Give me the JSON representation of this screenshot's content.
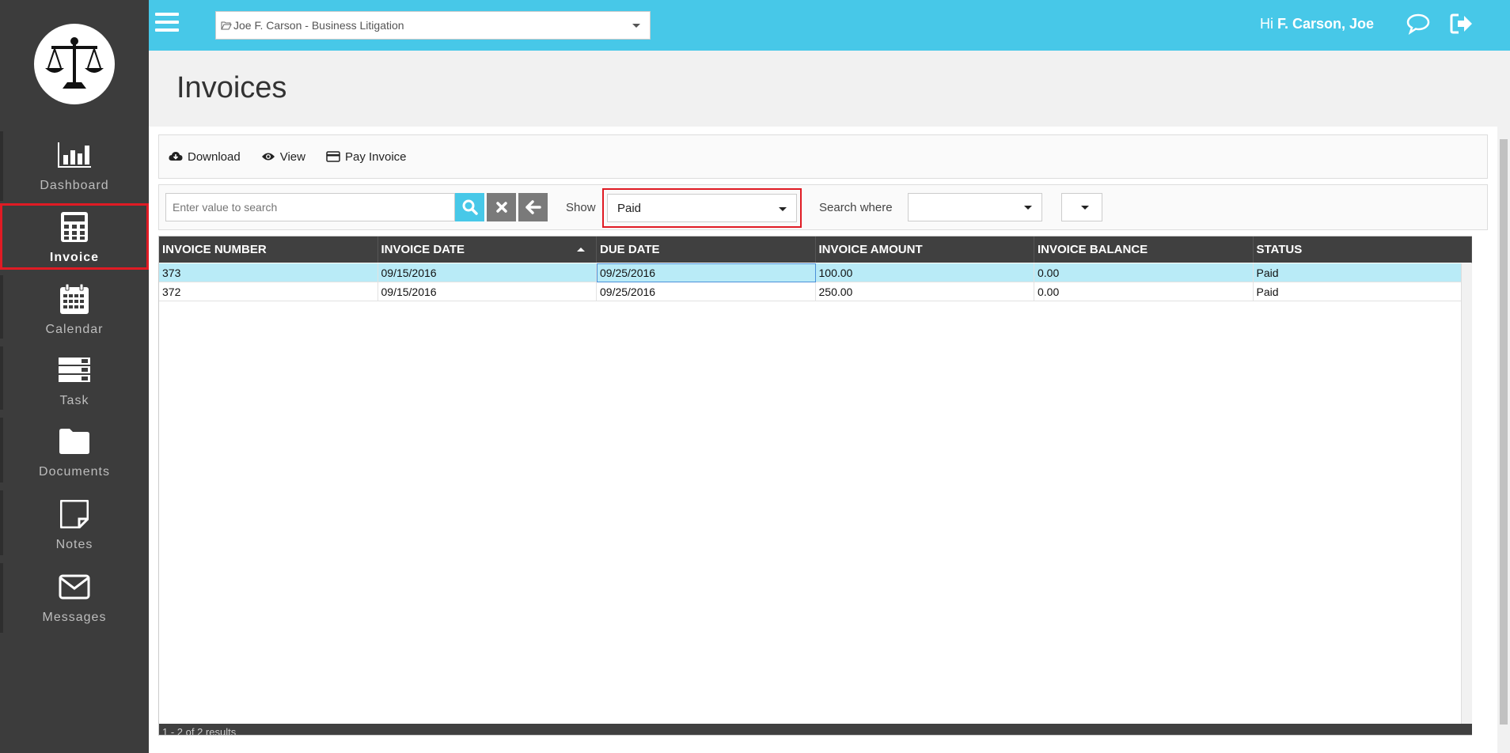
{
  "topbar": {
    "matter": "Joe F. Carson - Business Litigation",
    "greeting_prefix": "Hi",
    "greeting_name": "F. Carson, Joe"
  },
  "sidebar": {
    "items": [
      {
        "label": "Dashboard",
        "icon": "bar-chart-icon"
      },
      {
        "label": "Invoice",
        "icon": "calculator-icon",
        "active": true
      },
      {
        "label": "Calendar",
        "icon": "calendar-icon"
      },
      {
        "label": "Task",
        "icon": "tasks-icon"
      },
      {
        "label": "Documents",
        "icon": "folder-icon"
      },
      {
        "label": "Notes",
        "icon": "note-icon"
      },
      {
        "label": "Messages",
        "icon": "envelope-icon"
      }
    ]
  },
  "page": {
    "title": "Invoices"
  },
  "toolbar": {
    "download_label": "Download",
    "view_label": "View",
    "pay_label": "Pay Invoice"
  },
  "filter": {
    "search_placeholder": "Enter value to search",
    "show_label": "Show",
    "show_value": "Paid",
    "search_where_label": "Search where"
  },
  "grid": {
    "columns": [
      "INVOICE NUMBER",
      "INVOICE DATE",
      "DUE DATE",
      "INVOICE AMOUNT",
      "INVOICE BALANCE",
      "STATUS"
    ],
    "rows": [
      [
        "373",
        "09/15/2016",
        "09/25/2016",
        "100.00",
        "0.00",
        "Paid"
      ],
      [
        "372",
        "09/15/2016",
        "09/25/2016",
        "250.00",
        "0.00",
        "Paid"
      ]
    ],
    "footer": "1 - 2 of 2 results"
  },
  "colors": {
    "topbar": "#47c8e8",
    "sidebar": "#3c3c3c",
    "highlight": "#e01b24",
    "selected_row": "#b9ebf7"
  }
}
